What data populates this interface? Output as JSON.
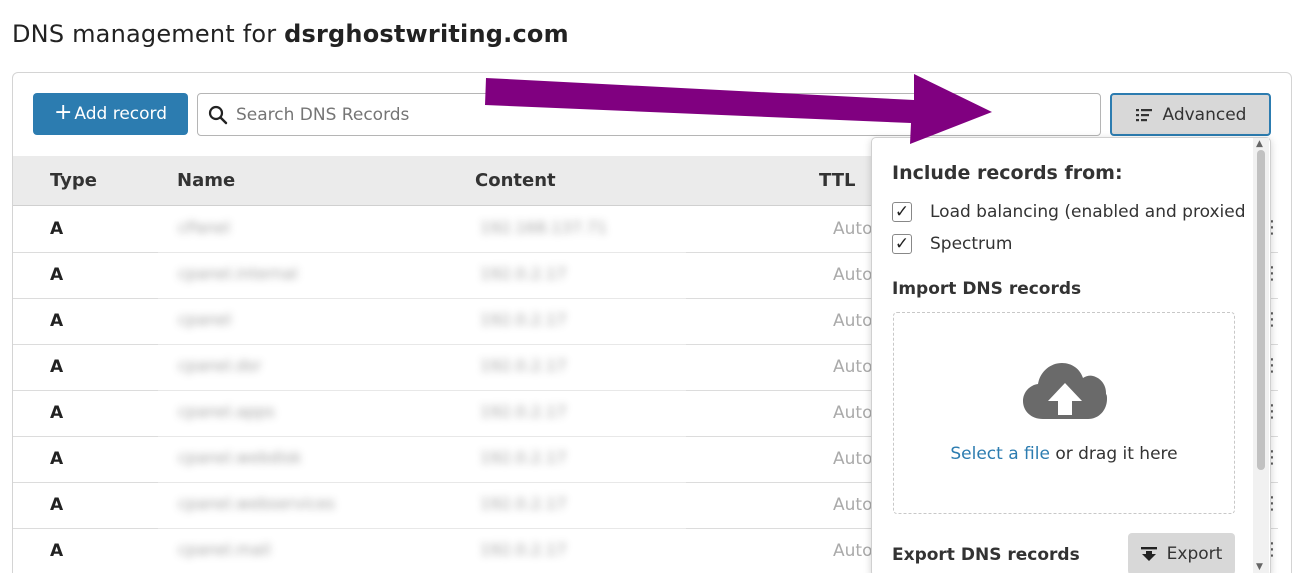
{
  "page": {
    "title_prefix": "DNS management for ",
    "domain": "dsrghostwriting.com"
  },
  "toolbar": {
    "add_icon": "+",
    "add_label": "Add record",
    "search_placeholder": "Search DNS Records",
    "advanced_label": "Advanced"
  },
  "table": {
    "headers": {
      "type": "Type",
      "name": "Name",
      "content": "Content",
      "ttl": "TTL"
    },
    "rows": [
      {
        "type": "A",
        "name": "cPanel",
        "content": "192.168.137.71",
        "ttl": "Auto"
      },
      {
        "type": "A",
        "name": "cpanel.internal",
        "content": "192.0.2.17",
        "ttl": "Auto"
      },
      {
        "type": "A",
        "name": "cpanel",
        "content": "192.0.2.17",
        "ttl": "Auto"
      },
      {
        "type": "A",
        "name": "cpanel.dsr",
        "content": "192.0.2.17",
        "ttl": "Auto"
      },
      {
        "type": "A",
        "name": "cpanel.apps",
        "content": "192.0.2.17",
        "ttl": "Auto"
      },
      {
        "type": "A",
        "name": "cpanel.webdisk",
        "content": "192.0.2.17",
        "ttl": "Auto"
      },
      {
        "type": "A",
        "name": "cpanel.webservices",
        "content": "192.0.2.17",
        "ttl": "Auto"
      },
      {
        "type": "A",
        "name": "cpanel.mail",
        "content": "192.0.2.17",
        "ttl": "Auto"
      }
    ],
    "more_icon": "⋮"
  },
  "advanced_menu": {
    "include_heading": "Include records from:",
    "include_options": [
      {
        "label": "Load balancing (enabled and proxied",
        "checked": true
      },
      {
        "label": "Spectrum",
        "checked": true
      }
    ],
    "check_mark": "✓",
    "import_heading": "Import DNS records",
    "dropzone_link": "Select a file",
    "dropzone_text": " or drag it here",
    "export_heading": "Export DNS records",
    "export_label": "Export"
  },
  "icons": {
    "search": "search-icon",
    "advanced": "list-filter-icon",
    "upload": "cloud-upload-icon",
    "export": "download-icon"
  },
  "colors": {
    "primary": "#2c7cb0",
    "annotation_arrow": "#800080"
  }
}
